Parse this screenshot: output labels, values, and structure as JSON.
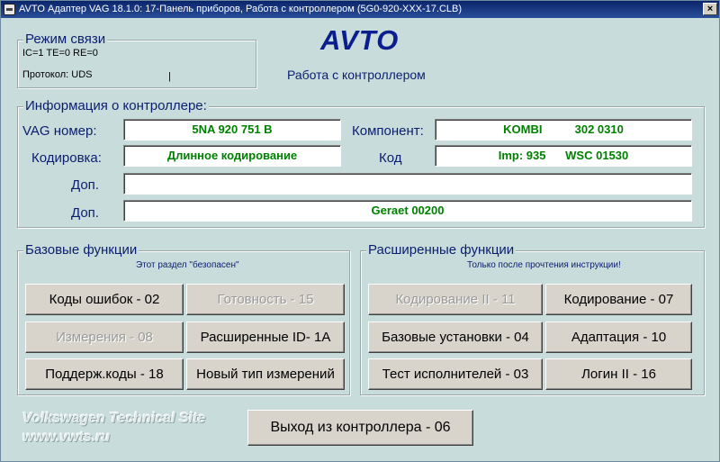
{
  "window": {
    "title": "AVTO Адаптер VAG 18.1.0: 17-Панель приборов,  Работа с контроллером (5G0-920-XXX-17.CLB)",
    "close_label": "×"
  },
  "connection": {
    "title": "Режим связи",
    "status_line": "IC=1  TE=0   RE=0",
    "protocol": "Протокол: UDS",
    "indicator": "|"
  },
  "header": {
    "logo": "AVTO",
    "subtitle": "Работа с контроллером"
  },
  "controller_info": {
    "title": "Информация о контроллере:",
    "vag_label": "VAG номер:",
    "vag_value": "5NA 920 751 B",
    "component_label": "Компонент:",
    "component_value": "KOMBI          302 0310",
    "coding_label": "Кодировка:",
    "coding_value": "Длинное кодирование",
    "code_label": "Код",
    "code_value": "Imp: 935      WSC 01530",
    "extra1_label": "Доп.",
    "extra1_value": "",
    "extra2_label": "Доп.",
    "extra2_value": "Geraet 00200"
  },
  "basic": {
    "title": "Базовые функции",
    "note": "Этот раздел \"безопасен\"",
    "buttons": [
      {
        "label": "Коды ошибок - 02"
      },
      {
        "label": "Готовность - 15"
      },
      {
        "label": "Измерения - 08"
      },
      {
        "label": "Расширенные ID- 1A"
      },
      {
        "label": "Поддерж.коды - 18"
      },
      {
        "label": "Новый тип измерений"
      }
    ]
  },
  "advanced": {
    "title": "Расширенные функции",
    "note": "Только после прочтения инструкции!",
    "buttons": [
      {
        "label": "Кодирование II - 11"
      },
      {
        "label": "Кодирование - 07"
      },
      {
        "label": "Базовые установки - 04"
      },
      {
        "label": "Адаптация - 10"
      },
      {
        "label": "Тест исполнителей - 03"
      },
      {
        "label": "Логин II - 16"
      }
    ]
  },
  "exit": {
    "label": "Выход из контроллера - 06"
  },
  "watermark": {
    "line1": "Volkswagen Technical Site",
    "line2": "www.vwts.ru"
  }
}
